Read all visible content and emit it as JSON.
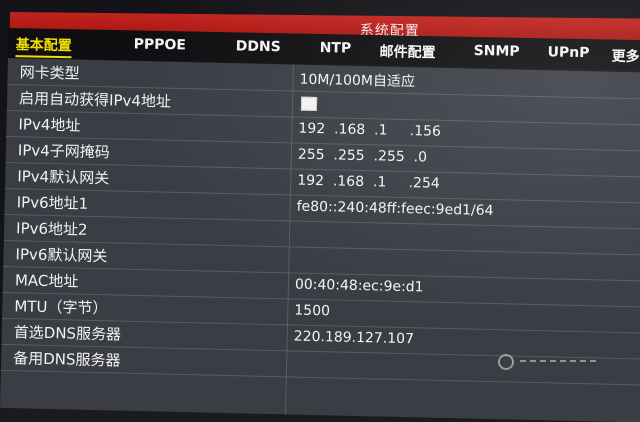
{
  "window": {
    "title": "系统配置"
  },
  "tabs": [
    {
      "label": "基本配置",
      "active": true
    },
    {
      "label": "PPPOE"
    },
    {
      "label": "DDNS"
    },
    {
      "label": "NTP"
    },
    {
      "label": "邮件配置"
    },
    {
      "label": "SNMP"
    },
    {
      "label": "UPnP"
    },
    {
      "label": "更多"
    }
  ],
  "form": {
    "nic_type": {
      "label": "网卡类型",
      "value": "10M/100M自适应"
    },
    "dhcp": {
      "label": "启用自动获得IPv4地址",
      "checked": false
    },
    "ipv4_address": {
      "label": "IPv4地址",
      "value": "192  .168  .1     .156"
    },
    "ipv4_mask": {
      "label": "IPv4子网掩码",
      "value": "255  .255  .255  .0"
    },
    "ipv4_gateway": {
      "label": "IPv4默认网关",
      "value": "192  .168  .1     .254"
    },
    "ipv6_address1": {
      "label": "IPv6地址1",
      "value": "fe80::240:48ff:feec:9ed1/64"
    },
    "ipv6_address2": {
      "label": "IPv6地址2",
      "value": ""
    },
    "ipv6_gateway": {
      "label": "IPv6默认网关",
      "value": ""
    },
    "mac_address": {
      "label": "MAC地址",
      "value": "00:40:48:ec:9e:d1"
    },
    "mtu": {
      "label": "MTU（字节）",
      "value": "1500"
    },
    "primary_dns": {
      "label": "首选DNS服务器",
      "value": "220.189.127.107"
    },
    "secondary_dns": {
      "label": "备用DNS服务器",
      "value": ""
    }
  },
  "colors": {
    "title_bar": "#b81c17",
    "active_tab": "#f0e000",
    "panel": "#3b3d45"
  }
}
